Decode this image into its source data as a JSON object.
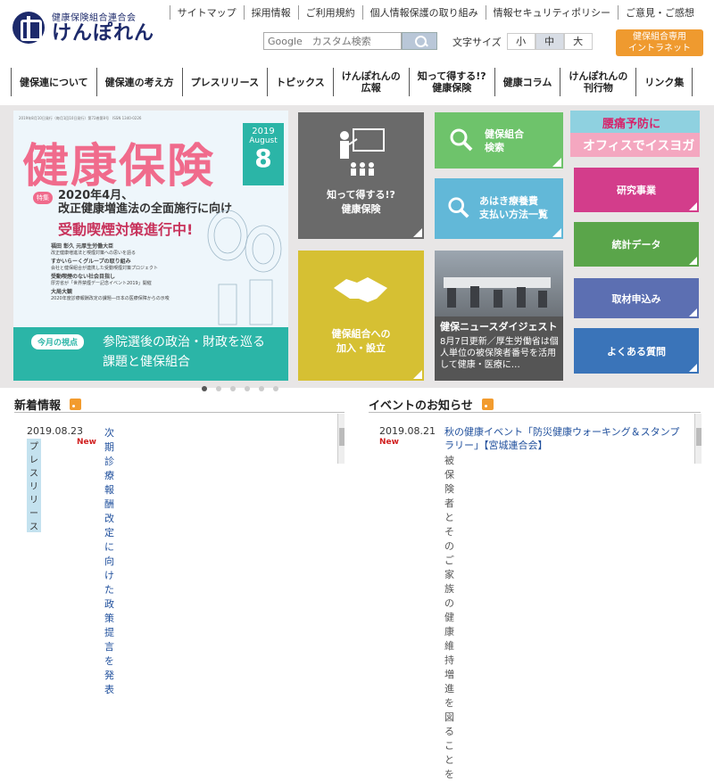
{
  "header": {
    "logo_sub": "健康保険組合連合会",
    "logo_main": "けんぽれん",
    "util_links": [
      "サイトマップ",
      "採用情報",
      "ご利用規約",
      "個人情報保護の取り組み",
      "情報セキュリティポリシー",
      "ご意見・ご感想"
    ],
    "search_placeholder": "Google　カスタム検索",
    "font_size_label": "文字サイズ",
    "font_sizes": [
      "小",
      "中",
      "大"
    ],
    "intranet_line1": "健保組合専用",
    "intranet_line2": "イントラネット"
  },
  "nav": [
    "健保連について",
    "健保連の考え方",
    "プレスリリース",
    "トピックス",
    "けんぽれんの\n広報",
    "知って得する!?\n健康保険",
    "健康コラム",
    "けんぽれんの\n刊行物",
    "リンク集"
  ],
  "magazine": {
    "top_small": "2019年8月10日発行（毎月1回10日発行）第72巻第8号　ISSN 1340-0226",
    "title": "健康保険",
    "year": "2019",
    "month": "August",
    "issue": "8",
    "feature_tag": "特集",
    "headline1": "2020年4月、\n改正健康増進法の全面施行に向け",
    "headline2": "受動喫煙対策進行中!",
    "items": [
      {
        "t": "福田 彰久 元厚生労働大臣",
        "s": "改正健康増進法と喫煙対策への思いを語る"
      },
      {
        "t": "すかいらーくグループの取り組み",
        "s": "会社と健保組合が連携した受動喫煙対策プロジェクト"
      },
      {
        "t": "受動喫煙のない社会目指し",
        "s": "厚労省が「世界禁煙デー記念イベント2019」開催"
      },
      {
        "t": "大局大観",
        "s": "2020年度診療報酬改定の課題―日本の医療保障からの示唆"
      }
    ],
    "view_tag": "今月の視点",
    "bottom_text": "参院選後の政治・財政を巡る\n課題と健保組合"
  },
  "tiles": {
    "know": "知って得する!?\n健康保険",
    "search": "健保組合\n検索",
    "massage": "あはき療養費\n支払い方法一覧",
    "join": "健保組合への\n加入・設立",
    "news_title": "健保ニュースダイジェスト",
    "news_text": "8月7日更新／厚生労働省は個人単位の被保険者番号を活用して健康・医療に…"
  },
  "banner": {
    "line1": "腰痛予防に",
    "line2": "オフィスでイスヨガ"
  },
  "side": [
    "研究事業",
    "統計データ",
    "取材申込み",
    "よくある質問"
  ],
  "news": {
    "heading": "新着情報",
    "items": [
      {
        "date": "2019.08.23",
        "tag": "プレスリリース",
        "new": "New",
        "title": "次期診療報酬改定に向けた政策提言を発表"
      }
    ]
  },
  "events": {
    "heading": "イベントのお知らせ",
    "items": [
      {
        "date": "2019.08.21",
        "new": "New",
        "title": "秋の健康イベント「防災健康ウォーキング＆スタンプラリー」【宮城連合会】",
        "sub": "被保険者とそのご家族の健康維持増進を図ることを"
      }
    ]
  },
  "colors": {
    "navy": "#1d2a6b",
    "teal": "#2bb5a7",
    "pink": "#f06b8c",
    "orange": "#ef9a2f"
  }
}
